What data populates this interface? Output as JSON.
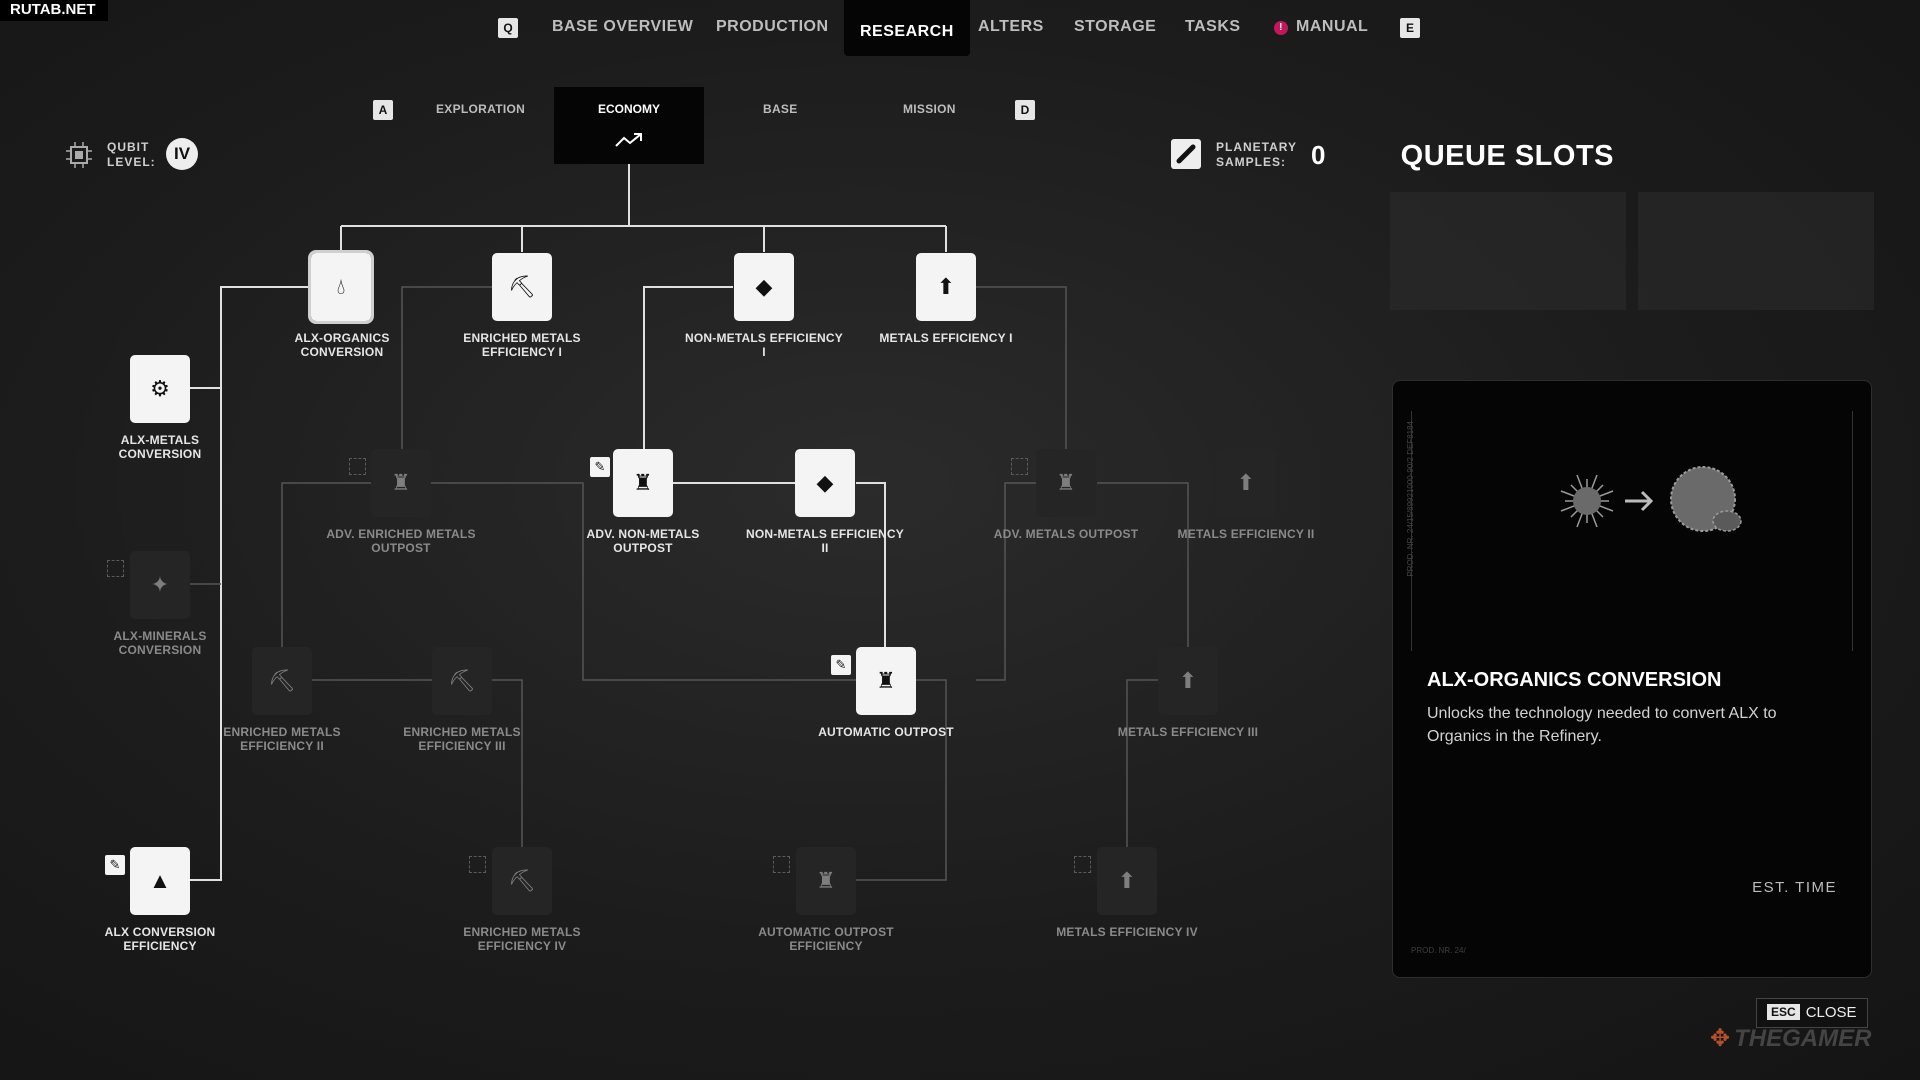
{
  "watermark": "RUTAB.NET",
  "topnav": {
    "key_left": "Q",
    "key_right": "E",
    "items": [
      "BASE OVERVIEW",
      "PRODUCTION",
      "RESEARCH",
      "ALTERS",
      "STORAGE",
      "TASKS",
      "MANUAL"
    ],
    "active": "RESEARCH",
    "manual_badge": "!"
  },
  "subnav": {
    "key_left": "A",
    "key_right": "D",
    "tabs": [
      "EXPLORATION",
      "ECONOMY",
      "BASE",
      "MISSION"
    ],
    "active": "ECONOMY"
  },
  "qubit": {
    "label": "QUBIT LEVEL:",
    "level": "IV"
  },
  "samples": {
    "label": "PLANETARY SAMPLES:",
    "value": "0"
  },
  "queue": {
    "title": "QUEUE SLOTS"
  },
  "nodes": [
    {
      "label": "ALX-ORGANICS CONVERSION",
      "state": "on",
      "icon": "drop-icon"
    },
    {
      "label": "ENRICHED METALS EFFICIENCY I",
      "state": "on",
      "icon": "ore-up-icon"
    },
    {
      "label": "NON-METALS EFFICIENCY I",
      "state": "on",
      "icon": "nonmetal-icon"
    },
    {
      "label": "METALS EFFICIENCY I",
      "state": "on",
      "icon": "metal-up-icon"
    },
    {
      "label": "ALX-METALS CONVERSION",
      "state": "on",
      "icon": "metal-convert-icon"
    },
    {
      "label": "ADV. ENRICHED METALS OUTPOST",
      "state": "off",
      "icon": "outpost-icon"
    },
    {
      "label": "ADV. NON-METALS OUTPOST",
      "state": "on",
      "icon": "outpost-icon"
    },
    {
      "label": "NON-METALS EFFICIENCY II",
      "state": "on",
      "icon": "nonmetal-icon"
    },
    {
      "label": "ADV. METALS OUTPOST",
      "state": "off",
      "icon": "outpost-icon"
    },
    {
      "label": "METALS EFFICIENCY II",
      "state": "off",
      "icon": "metal-up-icon"
    },
    {
      "label": "ALX-MINERALS CONVERSION",
      "state": "off",
      "icon": "mineral-icon"
    },
    {
      "label": "ENRICHED METALS EFFICIENCY II",
      "state": "off",
      "icon": "ore-up-icon"
    },
    {
      "label": "ENRICHED METALS EFFICIENCY III",
      "state": "off",
      "icon": "ore-up-icon"
    },
    {
      "label": "AUTOMATIC OUTPOST",
      "state": "on",
      "icon": "outpost-icon"
    },
    {
      "label": "METALS EFFICIENCY III",
      "state": "off",
      "icon": "metal-up-icon"
    },
    {
      "label": "ALX CONVERSION EFFICIENCY",
      "state": "on",
      "icon": "alx-icon"
    },
    {
      "label": "ENRICHED METALS EFFICIENCY IV",
      "state": "off",
      "icon": "ore-up-icon"
    },
    {
      "label": "AUTOMATIC OUTPOST EFFICIENCY",
      "state": "off",
      "icon": "outpost-icon"
    },
    {
      "label": "METALS EFFICIENCY IV",
      "state": "off",
      "icon": "metal-up-icon"
    }
  ],
  "detail": {
    "title": "ALX-ORGANICS CONVERSION",
    "description": "Unlocks the technology needed to convert ALX to Organics in the Refinery.",
    "est_time_label": "EST. TIME",
    "side_text": "PROD. NR. 24/15/89921000-90/2 DEF8184",
    "footer_text": "PROD. NR. 24/"
  },
  "close": {
    "key": "ESC",
    "label": "CLOSE"
  },
  "brand": "THEGAMER"
}
